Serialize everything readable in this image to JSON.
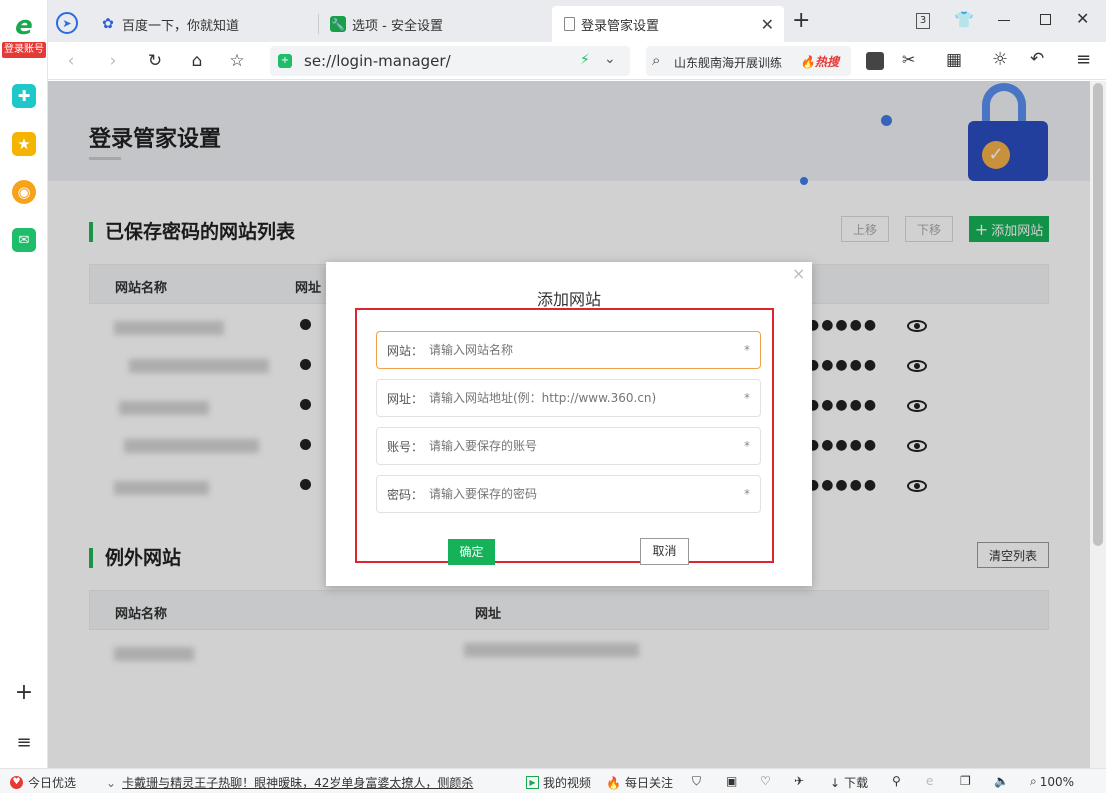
{
  "sidebar": {
    "badge": "登录账号",
    "add_icon": "+",
    "list_icon": "≡"
  },
  "tabs": [
    {
      "label": "百度一下，你就知道",
      "icon": "baidu-paw-icon"
    },
    {
      "label": "选项 - 安全设置",
      "icon": "wrench-icon"
    },
    {
      "label": "登录管家设置",
      "icon": "page-icon",
      "active": true
    }
  ],
  "tab_controls": {
    "new_tab": "+",
    "counter": "3"
  },
  "navbar": {
    "url": "se://login-manager/",
    "search_text": "山东舰南海开展训练",
    "hot_label": "热搜"
  },
  "page": {
    "title": "登录管家设置",
    "saved_section": {
      "title": "已保存密码的网站列表",
      "move_up": "上移",
      "move_down": "下移",
      "add_site": "添加网站",
      "col_name": "网站名称",
      "col_url": "网址",
      "rows": 5,
      "password_mask": "●●●●●"
    },
    "exception_section": {
      "title": "例外网站",
      "clear_list": "清空列表",
      "col_name": "网站名称",
      "col_url": "网址"
    }
  },
  "dialog": {
    "title": "添加网站",
    "close": "×",
    "fields": [
      {
        "label": "网站：",
        "placeholder": "请输入网站名称",
        "required": "*"
      },
      {
        "label": "网址：",
        "placeholder": "请输入网站地址(例：http://www.360.cn)",
        "required": "*"
      },
      {
        "label": "账号：",
        "placeholder": "请输入要保存的账号",
        "required": "*"
      },
      {
        "label": "密码：",
        "placeholder": "请输入要保存的密码",
        "required": "*"
      }
    ],
    "confirm": "确定",
    "cancel": "取消"
  },
  "statusbar": {
    "today": "今日优选",
    "news": "卡戴珊与精灵王子热聊！眼神暧昧，42岁单身富婆太撩人，侧颜杀",
    "my_video": "我的视频",
    "daily_follow": "每日关注",
    "download": "下载",
    "zoom": "100%"
  },
  "colors": {
    "accent": "#16b25a",
    "highlight": "#e0242f",
    "input_focus": "#f0a14a"
  }
}
